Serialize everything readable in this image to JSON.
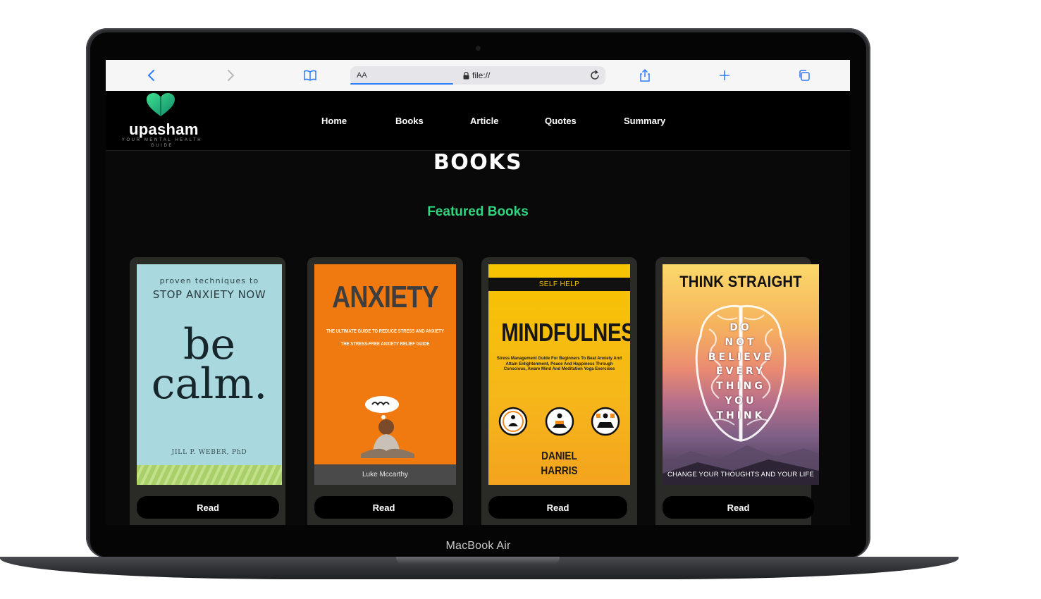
{
  "device": {
    "label": "MacBook Air"
  },
  "browser": {
    "aa_label": "AA",
    "url": "file://"
  },
  "site": {
    "logo_text": "upasham",
    "logo_tagline": "YOUR MENTAL HEALTH GUIDE",
    "nav": [
      "Home",
      "Books",
      "Article",
      "Quotes",
      "Summary"
    ],
    "page_title": "BOOKS",
    "section_title": "Featured Books",
    "accent_color": "#2fd47e"
  },
  "books": [
    {
      "read_label": "Read",
      "cover": {
        "top_line": "proven techniques to",
        "subtitle": "STOP ANXIETY NOW",
        "title_1": "be",
        "title_2": "calm.",
        "author": "JILL P. WEBER, PhD"
      }
    },
    {
      "read_label": "Read",
      "cover": {
        "title": "ANXIETY",
        "subtitle_1": "THE ULTIMATE GUIDE TO REDUCE STRESS AND ANXIETY",
        "subtitle_2": "THE STRESS-FREE ANXIETY RELIEF GUIDE",
        "author": "Luke Mccarthy"
      }
    },
    {
      "read_label": "Read",
      "cover": {
        "band": "SELF HELP",
        "title": "MINDFULNESS",
        "subtitle": "Stress Management Guide For Beginners To Beat Anxiety And Attain Enlightenment, Peace And Happiness Through Conscious, Aware Mind And Meditation Yoga Exercises",
        "author_1": "DANIEL",
        "author_2": "HARRIS"
      }
    },
    {
      "read_label": "Read",
      "cover": {
        "title": "THINK STRAIGHT",
        "lines": [
          "DO",
          "NOT",
          "BELIEVE",
          "EVERY",
          "THING",
          "YOU",
          "THINK"
        ],
        "footer": "CHANGE YOUR THOUGHTS AND YOUR LIFE"
      }
    }
  ]
}
